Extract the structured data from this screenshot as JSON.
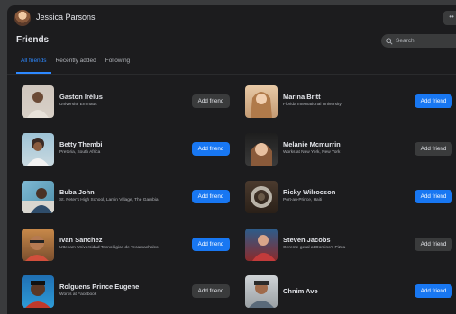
{
  "header": {
    "user_name": "Jessica Parsons",
    "more_label": "••"
  },
  "page": {
    "title": "Friends",
    "search_placeholder": "Search"
  },
  "tabs": [
    {
      "label": "All friends",
      "active": true
    },
    {
      "label": "Recently added",
      "active": false
    },
    {
      "label": "Following",
      "active": false
    }
  ],
  "friends_left": [
    {
      "name": "Gaston Irélus",
      "subtitle": "Université Emmaüs",
      "button": "Add friend",
      "style": "gray"
    },
    {
      "name": "Betty Thembi",
      "subtitle": "Pretoria, South Africa",
      "button": "Add friend",
      "style": "blue"
    },
    {
      "name": "Buba John",
      "subtitle": "St. Peter's High School, Lamin Village, The Gambia",
      "button": "Add friend",
      "style": "blue"
    },
    {
      "name": "Ivan Sanchez",
      "subtitle": "Uttecam Universidad Tecnológica de Tecamachalco",
      "button": "Add friend",
      "style": "blue"
    },
    {
      "name": "Rolguens Prince Eugene",
      "subtitle": "Works at Facebook",
      "button": "Add friend",
      "style": "gray"
    }
  ],
  "friends_right": [
    {
      "name": "Marina Britt",
      "subtitle": "Florida International University",
      "button": "Add friend",
      "style": "blue"
    },
    {
      "name": "Melanie Mcmurrin",
      "subtitle": "Works at New York, New York",
      "button": "Add friend",
      "style": "gray"
    },
    {
      "name": "Ricky Wilrocson",
      "subtitle": "Port-au-Prince, Haiti",
      "button": "Add friend",
      "style": "blue"
    },
    {
      "name": "Steven Jacobs",
      "subtitle": "Gerente-geral at Domino's Pizza",
      "button": "Add friend",
      "style": "gray"
    },
    {
      "name": "Chnim Ave",
      "subtitle": "",
      "button": "Add friend",
      "style": "blue"
    }
  ],
  "colors": {
    "accent": "#1877f2",
    "tab_active": "#2d88ff",
    "background": "#1c1c1e",
    "button_gray": "#3a3b3c"
  }
}
